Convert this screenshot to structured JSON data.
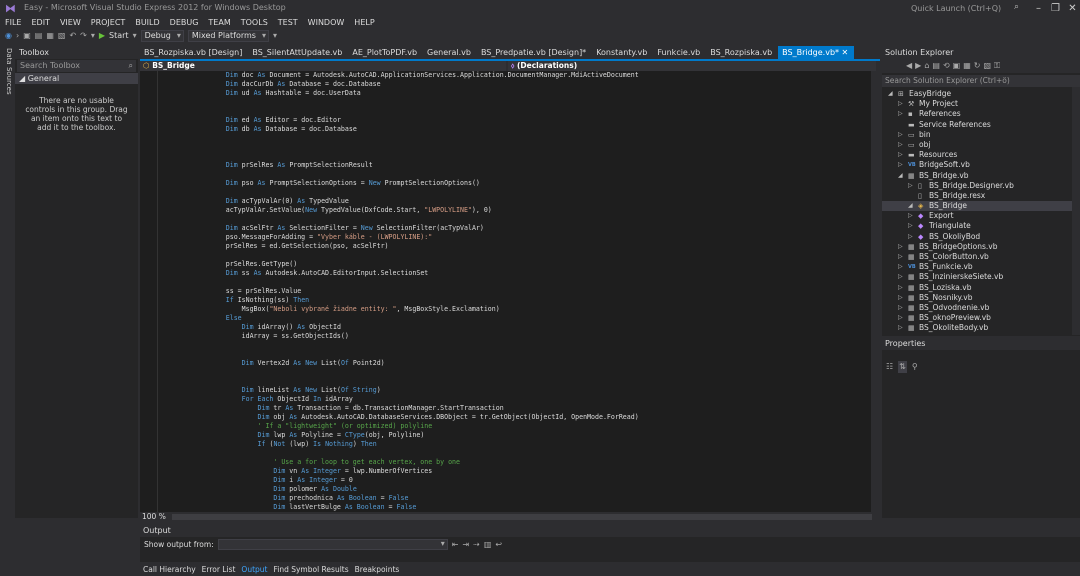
{
  "window": {
    "title": "Easy - Microsoft Visual Studio Express 2012 for Windows Desktop",
    "quick_launch_placeholder": "Quick Launch (Ctrl+Q)"
  },
  "menu": [
    "FILE",
    "EDIT",
    "VIEW",
    "PROJECT",
    "BUILD",
    "DEBUG",
    "TEAM",
    "TOOLS",
    "TEST",
    "WINDOW",
    "HELP"
  ],
  "toolbar": {
    "start_label": "Start",
    "config": "Debug",
    "platform": "Mixed Platforms"
  },
  "left_strip": {
    "data_sources": "Data Sources"
  },
  "toolbox": {
    "title": "Toolbox",
    "search_placeholder": "Search Toolbox",
    "group": "General",
    "empty_message": "There are no usable controls in this group. Drag an item onto this text to add it to the toolbox."
  },
  "tabs": [
    {
      "label": "BS_Rozpiska.vb [Design]",
      "active": false
    },
    {
      "label": "BS_SilentAttUpdate.vb",
      "active": false
    },
    {
      "label": "AE_PlotToPDF.vb",
      "active": false
    },
    {
      "label": "General.vb",
      "active": false
    },
    {
      "label": "BS_Predpatie.vb [Design]*",
      "active": false
    },
    {
      "label": "Konstanty.vb",
      "active": false
    },
    {
      "label": "Funkcie.vb",
      "active": false
    },
    {
      "label": "BS_Rozpiska.vb",
      "active": false
    },
    {
      "label": "BS_Bridge.vb*",
      "active": true
    }
  ],
  "navbar": {
    "left": "BS_Bridge",
    "right": "(Declarations)"
  },
  "editor": {
    "zoom": "100 %",
    "lines": [
      [
        [
          "pl",
          "        "
        ],
        [
          "kw",
          "Dim"
        ],
        [
          "pl",
          " doc "
        ],
        [
          "kw",
          "As"
        ],
        [
          "pl",
          " Document = Autodesk.AutoCAD.ApplicationServices.Application.DocumentManager.MdiActiveDocument"
        ]
      ],
      [
        [
          "pl",
          "        "
        ],
        [
          "kw",
          "Dim"
        ],
        [
          "pl",
          " dacCurDb "
        ],
        [
          "kw",
          "As"
        ],
        [
          "pl",
          " Database = doc.Database"
        ]
      ],
      [
        [
          "pl",
          "        "
        ],
        [
          "kw",
          "Dim"
        ],
        [
          "pl",
          " ud "
        ],
        [
          "kw",
          "As"
        ],
        [
          "pl",
          " Hashtable = doc.UserData"
        ]
      ],
      [],
      [],
      [
        [
          "pl",
          "        "
        ],
        [
          "kw",
          "Dim"
        ],
        [
          "pl",
          " ed "
        ],
        [
          "kw",
          "As"
        ],
        [
          "pl",
          " Editor = doc.Editor"
        ]
      ],
      [
        [
          "pl",
          "        "
        ],
        [
          "kw",
          "Dim"
        ],
        [
          "pl",
          " db "
        ],
        [
          "kw",
          "As"
        ],
        [
          "pl",
          " Database = doc.Database"
        ]
      ],
      [],
      [],
      [],
      [
        [
          "pl",
          "        "
        ],
        [
          "kw",
          "Dim"
        ],
        [
          "pl",
          " prSelRes "
        ],
        [
          "kw",
          "As"
        ],
        [
          "pl",
          " PromptSelectionResult"
        ]
      ],
      [],
      [
        [
          "pl",
          "        "
        ],
        [
          "kw",
          "Dim"
        ],
        [
          "pl",
          " pso "
        ],
        [
          "kw",
          "As"
        ],
        [
          "pl",
          " PromptSelectionOptions = "
        ],
        [
          "kw",
          "New"
        ],
        [
          "pl",
          " PromptSelectionOptions()"
        ]
      ],
      [],
      [
        [
          "pl",
          "        "
        ],
        [
          "kw",
          "Dim"
        ],
        [
          "pl",
          " acTypValAr(0) "
        ],
        [
          "kw",
          "As"
        ],
        [
          "pl",
          " TypedValue"
        ]
      ],
      [
        [
          "pl",
          "        acTypValAr.SetValue("
        ],
        [
          "kw",
          "New"
        ],
        [
          "pl",
          " TypedValue(DxfCode.Start, "
        ],
        [
          "st",
          "\"LWPOLYLINE\""
        ],
        [
          "pl",
          "), 0)"
        ]
      ],
      [],
      [
        [
          "pl",
          "        "
        ],
        [
          "kw",
          "Dim"
        ],
        [
          "pl",
          " acSelFtr "
        ],
        [
          "kw",
          "As"
        ],
        [
          "pl",
          " SelectionFilter = "
        ],
        [
          "kw",
          "New"
        ],
        [
          "pl",
          " SelectionFilter(acTypValAr)"
        ]
      ],
      [
        [
          "pl",
          "        pso.MessageForAdding = "
        ],
        [
          "st",
          "\"Vyber káble - (LWPOLYLINE):\""
        ]
      ],
      [
        [
          "pl",
          "        prSelRes = ed.GetSelection(pso, acSelFtr)"
        ]
      ],
      [],
      [
        [
          "pl",
          "        prSelRes.GetType()"
        ]
      ],
      [
        [
          "pl",
          "        "
        ],
        [
          "kw",
          "Dim"
        ],
        [
          "pl",
          " ss "
        ],
        [
          "kw",
          "As"
        ],
        [
          "pl",
          " Autodesk.AutoCAD.EditorInput.SelectionSet"
        ]
      ],
      [],
      [
        [
          "pl",
          "        ss = prSelRes.Value"
        ]
      ],
      [
        [
          "pl",
          "        "
        ],
        [
          "kw",
          "If"
        ],
        [
          "pl",
          " IsNothing(ss) "
        ],
        [
          "kw",
          "Then"
        ]
      ],
      [
        [
          "pl",
          "            MsgBox("
        ],
        [
          "st",
          "\"Neboli vybrané žiadne entity: \""
        ],
        [
          "pl",
          ", MsgBoxStyle.Exclamation)"
        ]
      ],
      [
        [
          "pl",
          "        "
        ],
        [
          "kw",
          "Else"
        ]
      ],
      [
        [
          "pl",
          "            "
        ],
        [
          "kw",
          "Dim"
        ],
        [
          "pl",
          " idArray() "
        ],
        [
          "kw",
          "As"
        ],
        [
          "pl",
          " ObjectId"
        ]
      ],
      [
        [
          "pl",
          "            idArray = ss.GetObjectIds()"
        ]
      ],
      [],
      [],
      [
        [
          "pl",
          "            "
        ],
        [
          "kw",
          "Dim"
        ],
        [
          "pl",
          " Vertex2d "
        ],
        [
          "kw",
          "As"
        ],
        [
          "pl",
          " "
        ],
        [
          "kw",
          "New"
        ],
        [
          "pl",
          " List("
        ],
        [
          "kw",
          "Of"
        ],
        [
          "pl",
          " Point2d)"
        ]
      ],
      [],
      [],
      [
        [
          "pl",
          "            "
        ],
        [
          "kw",
          "Dim"
        ],
        [
          "pl",
          " lineList "
        ],
        [
          "kw",
          "As"
        ],
        [
          "pl",
          " "
        ],
        [
          "kw",
          "New"
        ],
        [
          "pl",
          " List("
        ],
        [
          "kw",
          "Of"
        ],
        [
          "pl",
          " "
        ],
        [
          "kw",
          "String"
        ],
        [
          "pl",
          ")"
        ]
      ],
      [
        [
          "pl",
          "            "
        ],
        [
          "kw",
          "For Each"
        ],
        [
          "pl",
          " ObjectId "
        ],
        [
          "kw",
          "In"
        ],
        [
          "pl",
          " idArray"
        ]
      ],
      [
        [
          "pl",
          "                "
        ],
        [
          "kw",
          "Dim"
        ],
        [
          "pl",
          " tr "
        ],
        [
          "kw",
          "As"
        ],
        [
          "pl",
          " Transaction = db.TransactionManager.StartTransaction"
        ]
      ],
      [
        [
          "pl",
          "                "
        ],
        [
          "kw",
          "Dim"
        ],
        [
          "pl",
          " obj "
        ],
        [
          "kw",
          "As"
        ],
        [
          "pl",
          " Autodesk.AutoCAD.DatabaseServices.DBObject = tr.GetObject(ObjectId, OpenMode.ForRead)"
        ]
      ],
      [
        [
          "cm",
          "                ' If a \"lightweight\" (or optimized) polyline"
        ]
      ],
      [
        [
          "pl",
          "                "
        ],
        [
          "kw",
          "Dim"
        ],
        [
          "pl",
          " lwp "
        ],
        [
          "kw",
          "As"
        ],
        [
          "pl",
          " Polyline = "
        ],
        [
          "kw",
          "CType"
        ],
        [
          "pl",
          "(obj, Polyline)"
        ]
      ],
      [
        [
          "pl",
          "                "
        ],
        [
          "kw",
          "If"
        ],
        [
          "pl",
          " ("
        ],
        [
          "kw",
          "Not"
        ],
        [
          "pl",
          " (lwp) "
        ],
        [
          "kw",
          "Is Nothing"
        ],
        [
          "pl",
          ") "
        ],
        [
          "kw",
          "Then"
        ]
      ],
      [],
      [
        [
          "cm",
          "                    ' Use a for loop to get each vertex, one by one"
        ]
      ],
      [
        [
          "pl",
          "                    "
        ],
        [
          "kw",
          "Dim"
        ],
        [
          "pl",
          " vn "
        ],
        [
          "kw",
          "As Integer"
        ],
        [
          "pl",
          " = lwp.NumberOfVertices"
        ]
      ],
      [
        [
          "pl",
          "                    "
        ],
        [
          "kw",
          "Dim"
        ],
        [
          "pl",
          " i "
        ],
        [
          "kw",
          "As Integer"
        ],
        [
          "pl",
          " = 0"
        ]
      ],
      [
        [
          "pl",
          "                    "
        ],
        [
          "kw",
          "Dim"
        ],
        [
          "pl",
          " polomer "
        ],
        [
          "kw",
          "As Double"
        ]
      ],
      [
        [
          "pl",
          "                    "
        ],
        [
          "kw",
          "Dim"
        ],
        [
          "pl",
          " prechodnica "
        ],
        [
          "kw",
          "As Boolean"
        ],
        [
          "pl",
          " = "
        ],
        [
          "kw",
          "False"
        ]
      ],
      [
        [
          "pl",
          "                    "
        ],
        [
          "kw",
          "Dim"
        ],
        [
          "pl",
          " lastVertBulge "
        ],
        [
          "kw",
          "As Boolean"
        ],
        [
          "pl",
          " = "
        ],
        [
          "kw",
          "False"
        ]
      ]
    ]
  },
  "solution_explorer": {
    "title": "Solution Explorer",
    "search_placeholder": "Search Solution Explorer (Ctrl+ö)",
    "items": [
      {
        "label": "EasyBridge",
        "level": 0,
        "arrow": "◢",
        "icon": "project",
        "selected": false
      },
      {
        "label": "My Project",
        "level": 1,
        "arrow": "▷",
        "icon": "wrench",
        "selected": false
      },
      {
        "label": "References",
        "level": 1,
        "arrow": "▷",
        "icon": "references",
        "selected": false
      },
      {
        "label": "Service References",
        "level": 1,
        "arrow": "",
        "icon": "folder",
        "selected": false
      },
      {
        "label": "bin",
        "level": 1,
        "arrow": "▷",
        "icon": "folder-outline",
        "selected": false
      },
      {
        "label": "obj",
        "level": 1,
        "arrow": "▷",
        "icon": "folder-outline",
        "selected": false
      },
      {
        "label": "Resources",
        "level": 1,
        "arrow": "▷",
        "icon": "folder",
        "selected": false
      },
      {
        "label": "BridgeSoft.vb",
        "level": 1,
        "arrow": "▷",
        "icon": "vb",
        "selected": false
      },
      {
        "label": "BS_Bridge.vb",
        "level": 1,
        "arrow": "◢",
        "icon": "form",
        "selected": false
      },
      {
        "label": "BS_Bridge.Designer.vb",
        "level": 2,
        "arrow": "▷",
        "icon": "file",
        "selected": false
      },
      {
        "label": "BS_Bridge.resx",
        "level": 2,
        "arrow": "",
        "icon": "file",
        "selected": false
      },
      {
        "label": "BS_Bridge",
        "level": 2,
        "arrow": "◢",
        "icon": "class",
        "selected": true
      },
      {
        "label": "Export",
        "level": 2,
        "arrow": "▷",
        "icon": "method",
        "selected": false
      },
      {
        "label": "Triangulate",
        "level": 2,
        "arrow": "▷",
        "icon": "method",
        "selected": false
      },
      {
        "label": "BS_OkoliyBod",
        "level": 2,
        "arrow": "▷",
        "icon": "method",
        "selected": false
      },
      {
        "label": "BS_BridgeOptions.vb",
        "level": 1,
        "arrow": "▷",
        "icon": "form",
        "selected": false
      },
      {
        "label": "BS_ColorButton.vb",
        "level": 1,
        "arrow": "▷",
        "icon": "form",
        "selected": false
      },
      {
        "label": "BS_Funkcie.vb",
        "level": 1,
        "arrow": "▷",
        "icon": "vb",
        "selected": false
      },
      {
        "label": "BS_InzinierskeSiete.vb",
        "level": 1,
        "arrow": "▷",
        "icon": "form",
        "selected": false
      },
      {
        "label": "BS_Loziska.vb",
        "level": 1,
        "arrow": "▷",
        "icon": "form",
        "selected": false
      },
      {
        "label": "BS_Nosniky.vb",
        "level": 1,
        "arrow": "▷",
        "icon": "form",
        "selected": false
      },
      {
        "label": "BS_Odvodnenie.vb",
        "level": 1,
        "arrow": "▷",
        "icon": "form",
        "selected": false
      },
      {
        "label": "BS_oknoPreview.vb",
        "level": 1,
        "arrow": "▷",
        "icon": "form",
        "selected": false
      },
      {
        "label": "BS_OkoliteBody.vb",
        "level": 1,
        "arrow": "▷",
        "icon": "form",
        "selected": false
      }
    ]
  },
  "properties": {
    "title": "Properties"
  },
  "output": {
    "title": "Output",
    "show_output_from": "Show output from:"
  },
  "bottom_tabs": [
    {
      "label": "Call Hierarchy",
      "active": false
    },
    {
      "label": "Error List",
      "active": false
    },
    {
      "label": "Output",
      "active": true
    },
    {
      "label": "Find Symbol Results",
      "active": false
    },
    {
      "label": "Breakpoints",
      "active": false
    }
  ],
  "colors": {
    "accent": "#007acc",
    "keyword": "#569cd6",
    "string": "#d69d85",
    "comment": "#57a64a"
  }
}
